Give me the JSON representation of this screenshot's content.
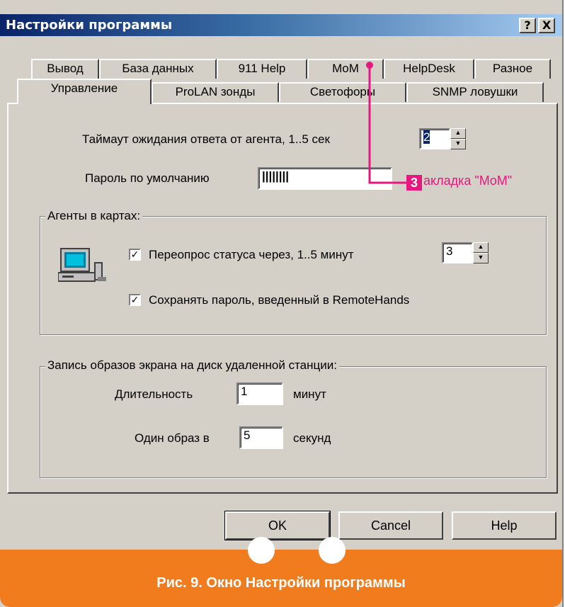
{
  "window": {
    "title": "Настройки программы",
    "help_button": "?",
    "close_button": "X"
  },
  "tabs": {
    "row_back": [
      "Вывод",
      "База данных",
      "911 Help",
      "MoM",
      "HelpDesk",
      "Разное"
    ],
    "row_front": [
      "Управление",
      "ProLAN зонды",
      "Светофоры",
      "SNMP ловушки"
    ],
    "active": "Управление"
  },
  "general": {
    "timeout_label": "Таймаут ожидания ответа от агента, 1..5 сек",
    "timeout_value": "2",
    "password_label": "Пароль по умолчанию",
    "password_value": "||||||||"
  },
  "agents_group": {
    "title": "Агенты в картах:",
    "icon": "computer-icon",
    "poll_label": "Переопрос статуса через, 1..5 минут",
    "poll_checked": true,
    "poll_value": "3",
    "save_password_label": "Сохранять пароль, введенный в RemoteHands",
    "save_password_checked": true,
    "check_mark": "✓"
  },
  "screen_group": {
    "title": "Запись образов экрана на диск удаленной станции:",
    "duration_label": "Длительность",
    "duration_value": "1",
    "duration_unit": "минут",
    "frame_label": "Один образ в",
    "frame_value": "5",
    "frame_unit": "секунд"
  },
  "buttons": {
    "ok": "OK",
    "cancel": "Cancel",
    "help": "Help"
  },
  "callout": {
    "number": "3",
    "text": "акладка \"MoM\"",
    "color": "#e6177e"
  },
  "caption": {
    "text": "Рис. 9. Окно Настройки программы",
    "color": "#f07c1e"
  }
}
